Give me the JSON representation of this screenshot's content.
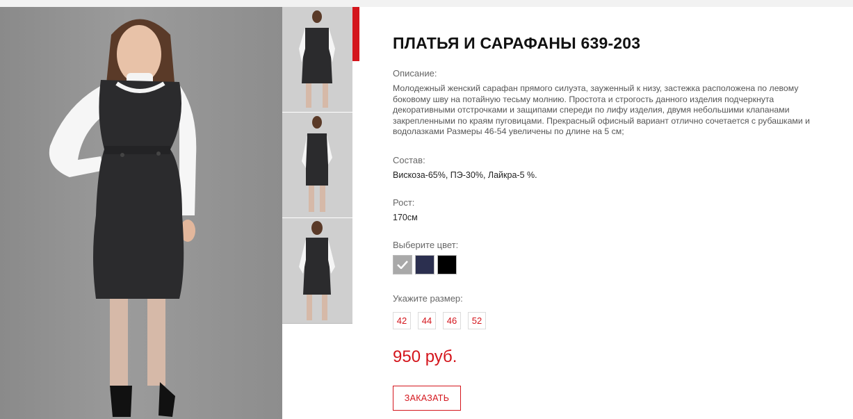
{
  "product": {
    "title": "ПЛАТЬЯ И САРАФАНЫ 639-203",
    "description_label": "Описание:",
    "description": "Молодежный женский сарафан прямого силуэта, зауженный к низу, застежка расположена по левому боковому шву на потайную тесьму молнию. Простота и строгость данного изделия подчеркнута декоративными отстрочками и защипами спереди по лифу изделия, двумя небольшими клапанами закрепленными по краям пуговицами. Прекрасный офисный вариант отлично сочетается с рубашками и водолазками Размеры 46-54 увеличены  по длине на 5 см;",
    "composition_label": "Состав:",
    "composition": "Вискоза-65%, ПЭ-30%, Лайкра-5 %.",
    "height_label": "Рост:",
    "height": "170см",
    "color_label": "Выберите цвет:",
    "colors": [
      {
        "name": "grey",
        "hex": "#a9a9a9",
        "selected": true
      },
      {
        "name": "navy",
        "hex": "#2b2f4f",
        "selected": false
      },
      {
        "name": "black",
        "hex": "#000000",
        "selected": false
      }
    ],
    "size_label": "Укажите размер:",
    "sizes": [
      "42",
      "44",
      "46",
      "52"
    ],
    "price": "950 руб.",
    "order_label": "ЗАКАЗАТЬ"
  },
  "accent_color": "#d4151c",
  "check_icon": "check-icon"
}
